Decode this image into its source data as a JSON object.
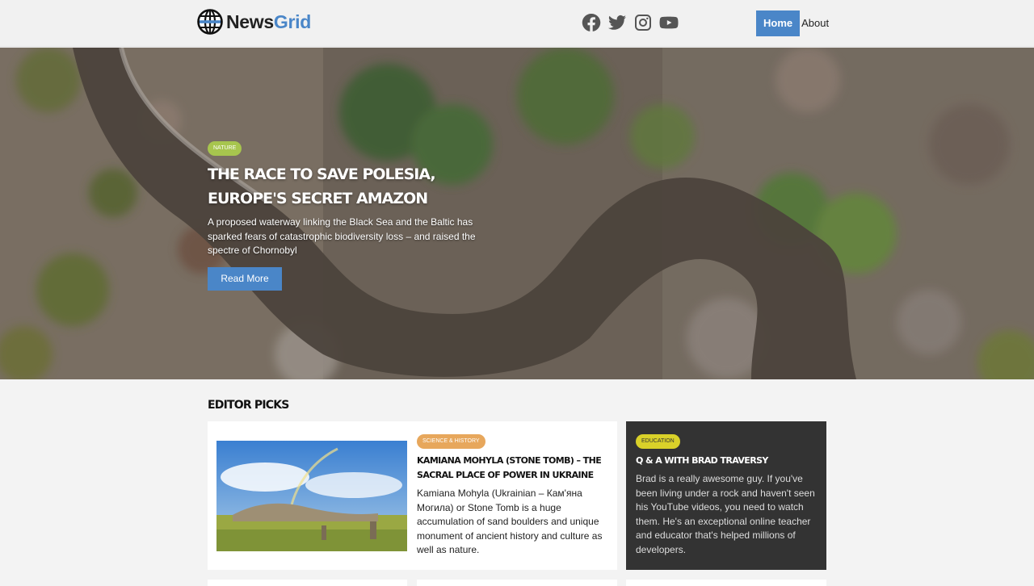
{
  "brand": {
    "name_part1": "News",
    "name_part2": "Grid",
    "accent": "#4a86c8"
  },
  "social": [
    {
      "icon": "facebook-icon"
    },
    {
      "icon": "twitter-icon"
    },
    {
      "icon": "instagram-icon"
    },
    {
      "icon": "youtube-icon"
    }
  ],
  "nav": {
    "home": "Home",
    "about": "About"
  },
  "hero": {
    "category": "Nature",
    "title": "The Race to Save Polesia, Europe's Secret Amazon",
    "text": "A proposed waterway linking the Black Sea and the Baltic has sparked fears of catastrophic biodiversity loss – and raised the spectre of Chornobyl",
    "button": "Read More"
  },
  "editor_picks": {
    "title": "Editor Picks",
    "main": {
      "category": "Science & History",
      "title": "Kamiana Mohyla (Stone Tomb) – The Sacral Place of Power in Ukraine",
      "text": "Kamiana Mohyla (Ukrainian – Кам'яна Могила) or Stone Tomb is a huge accumulation of sand boulders and unique monument of ancient history and culture as well as nature."
    },
    "side": {
      "category": "Education",
      "title": "Q & A with Brad Traversy",
      "text": "Brad is a really awesome guy. If you've been living under a rock and haven't seen his YouTube videos, you need to watch them. He's an exceptional online teacher and educator that's helped millions of developers."
    }
  },
  "colors": {
    "nature_tag": "#a7c54e",
    "science_tag": "#e7a75c",
    "education_tag": "#d9d129",
    "dark_card": "#333333"
  }
}
